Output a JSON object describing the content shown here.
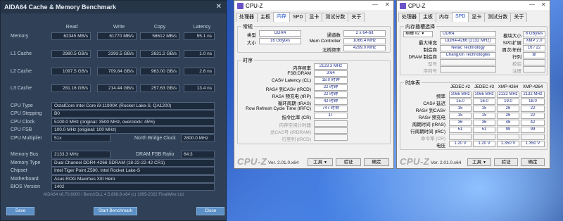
{
  "aida": {
    "title": "AIDA64 Cache & Memory Benchmark",
    "columns": [
      "Read",
      "Write",
      "Copy",
      "Latency"
    ],
    "rows": [
      {
        "label": "Memory",
        "read": "62345 MB/s",
        "write": "61770 MB/s",
        "copy": "58612 MB/s",
        "latency": "55.1 ns"
      },
      {
        "label": "L1 Cache",
        "read": "2980.5 GB/s",
        "write": "2393.5 GB/s",
        "copy": "2631.2 GB/s",
        "latency": "1.0 ns"
      },
      {
        "label": "L2 Cache",
        "read": "1097.5 GB/s",
        "write": "709.84 GB/s",
        "copy": "963.00 GB/s",
        "latency": "2.6 ns"
      },
      {
        "label": "L3 Cache",
        "read": "281.16 GB/s",
        "write": "214.44 GB/s",
        "copy": "257.63 GB/s",
        "latency": "13.4 ns"
      }
    ],
    "cpu": {
      "type_label": "CPU Type",
      "type": "OctalCore Intel Core i9-11900K  (Rocket Lake-S, QA1200)",
      "stepping_label": "CPU Stepping",
      "stepping": "B0",
      "clock_label": "CPU Clock",
      "clock": "5100.0 MHz  (original: 3500 MHz, overclock: 45%)",
      "fsb_label": "CPU FSB",
      "fsb": "100.0 MHz  (original: 100 MHz)",
      "mult_label": "CPU Multiplier",
      "mult": "51x",
      "nb_label": "North Bridge Clock",
      "nb": "2800.0 MHz"
    },
    "mem": {
      "bus_label": "Memory Bus",
      "bus": "2133.3 MHz",
      "ratio_label": "DRAM:FSB Ratio",
      "ratio": "64:3",
      "type_label": "Memory Type",
      "type": "Dual Channel DDR4-4266 SDRAM  (18-22-22-42 CR1)",
      "chipset_label": "Chipset",
      "chipset": "Intel Tiger Point Z590, Intel Rocket Lake-S",
      "mb_label": "Motherboard",
      "mb": "Asus ROG Maximus XIII Hero",
      "bios_label": "BIOS Version",
      "bios": "1402"
    },
    "footer": "AIDA64 v6.70.6000 / BenchDLL 4.5.868.8-x64  (c) 1995-2022 FinalWire Ltd.",
    "buttons": {
      "save": "Save",
      "start": "Start Benchmark",
      "close": "Close"
    }
  },
  "cpuz_mem": {
    "title": "CPU-Z",
    "tabs": [
      "处理器",
      "主板",
      "内存",
      "SPD",
      "显卡",
      "测试分数",
      "关于"
    ],
    "general_title": "常规",
    "type_label": "类型",
    "type": "DDR4",
    "channels_label": "通道数",
    "channels": "2 x 64-bit",
    "size_label": "大小",
    "size": "16 GBytes",
    "memctrl_label": "Mem Controller",
    "memctrl": "1066.4 MHz",
    "nb_label": "北桥频率",
    "nb": "4299.0 MHz",
    "timing_title": "时序",
    "timings": [
      {
        "label": "内存频率",
        "value": "2133.3 MHz"
      },
      {
        "label": "FSB:DRAM",
        "value": "3:64"
      },
      {
        "label": "CAS# Latency (CL)",
        "value": "18.0 时钟"
      },
      {
        "label": "RAS# 到CAS# (tRCD)",
        "value": "22 时钟"
      },
      {
        "label": "RAS# 预充电 (tRP)",
        "value": "22 时钟"
      },
      {
        "label": "循环周期 (tRAS)",
        "value": "42 时钟"
      },
      {
        "label": "Row Refresh Cycle Time (tRFC)",
        "value": "747 时钟"
      },
      {
        "label": "指令比率 (CR)",
        "value": "1T"
      },
      {
        "label": "内存空闲计时器",
        "value": ""
      },
      {
        "label": "总CAS号 (tRDRAM)",
        "value": ""
      },
      {
        "label": "行至列 (tRCD)",
        "value": ""
      }
    ],
    "brand": "CPU-Z",
    "version": "Ver. 2.01.0.x64",
    "tools": "工具",
    "validate": "验证",
    "ok": "确定"
  },
  "cpuz_spd": {
    "title": "CPU-Z",
    "tabs": [
      "处理器",
      "主板",
      "内存",
      "SPD",
      "显卡",
      "测试分数",
      "关于"
    ],
    "slot_group": "内存插槽选择",
    "slot": "插槽 #2",
    "type": "DDR4",
    "module_size_label": "模块大小",
    "module_size": "8 GBytes",
    "max_bw_label": "最大带宽",
    "max_bw": "DDR4-4266 (2132 MHz)",
    "spd_ext_label": "SPD扩展",
    "spd_ext": "XMP 2.0",
    "manuf_label": "制造商",
    "manuf": "Netac Technology",
    "week_label": "周次/年份",
    "week": "16 / 22",
    "dram_manuf_label": "DRAM 制造商",
    "dram_manuf": "ChangXin Technologies",
    "rank_label": "行列",
    "rank": "单",
    "part_label": "型号",
    "serial_label": "序列号",
    "correction_label": "校验",
    "registered_label": "注册",
    "timing_title": "时序表",
    "headers": [
      "JEDEC #2",
      "JEDEC #3",
      "XMP-4264",
      "XMP-4264"
    ],
    "rows": [
      {
        "label": "频率",
        "values": [
          "1066 MHz",
          "1066 MHz",
          "2132 MHz",
          "2132 MHz"
        ]
      },
      {
        "label": "CAS# 延迟",
        "values": [
          "15.0",
          "16.0",
          "19.0",
          "18.0"
        ]
      },
      {
        "label": "RAS# 到CAS#",
        "values": [
          "15",
          "15",
          "26",
          "22"
        ]
      },
      {
        "label": "RAS# 预充电",
        "values": [
          "15",
          "15",
          "26",
          "22"
        ]
      },
      {
        "label": "周期时间 (tRAS)",
        "values": [
          "36",
          "36",
          "46",
          "42"
        ]
      },
      {
        "label": "行周期时间 (tRC)",
        "values": [
          "51",
          "51",
          "99",
          "99"
        ]
      },
      {
        "label": "命令率 (CR)",
        "values": [
          "",
          "",
          "",
          ""
        ]
      },
      {
        "label": "电压",
        "values": [
          "1.20 V",
          "1.20 V",
          "1.350 V",
          "1.350 V"
        ]
      }
    ],
    "brand": "CPU-Z",
    "version": "Ver. 2.01.0.x64",
    "tools": "工具",
    "validate": "验证",
    "ok": "确定"
  }
}
